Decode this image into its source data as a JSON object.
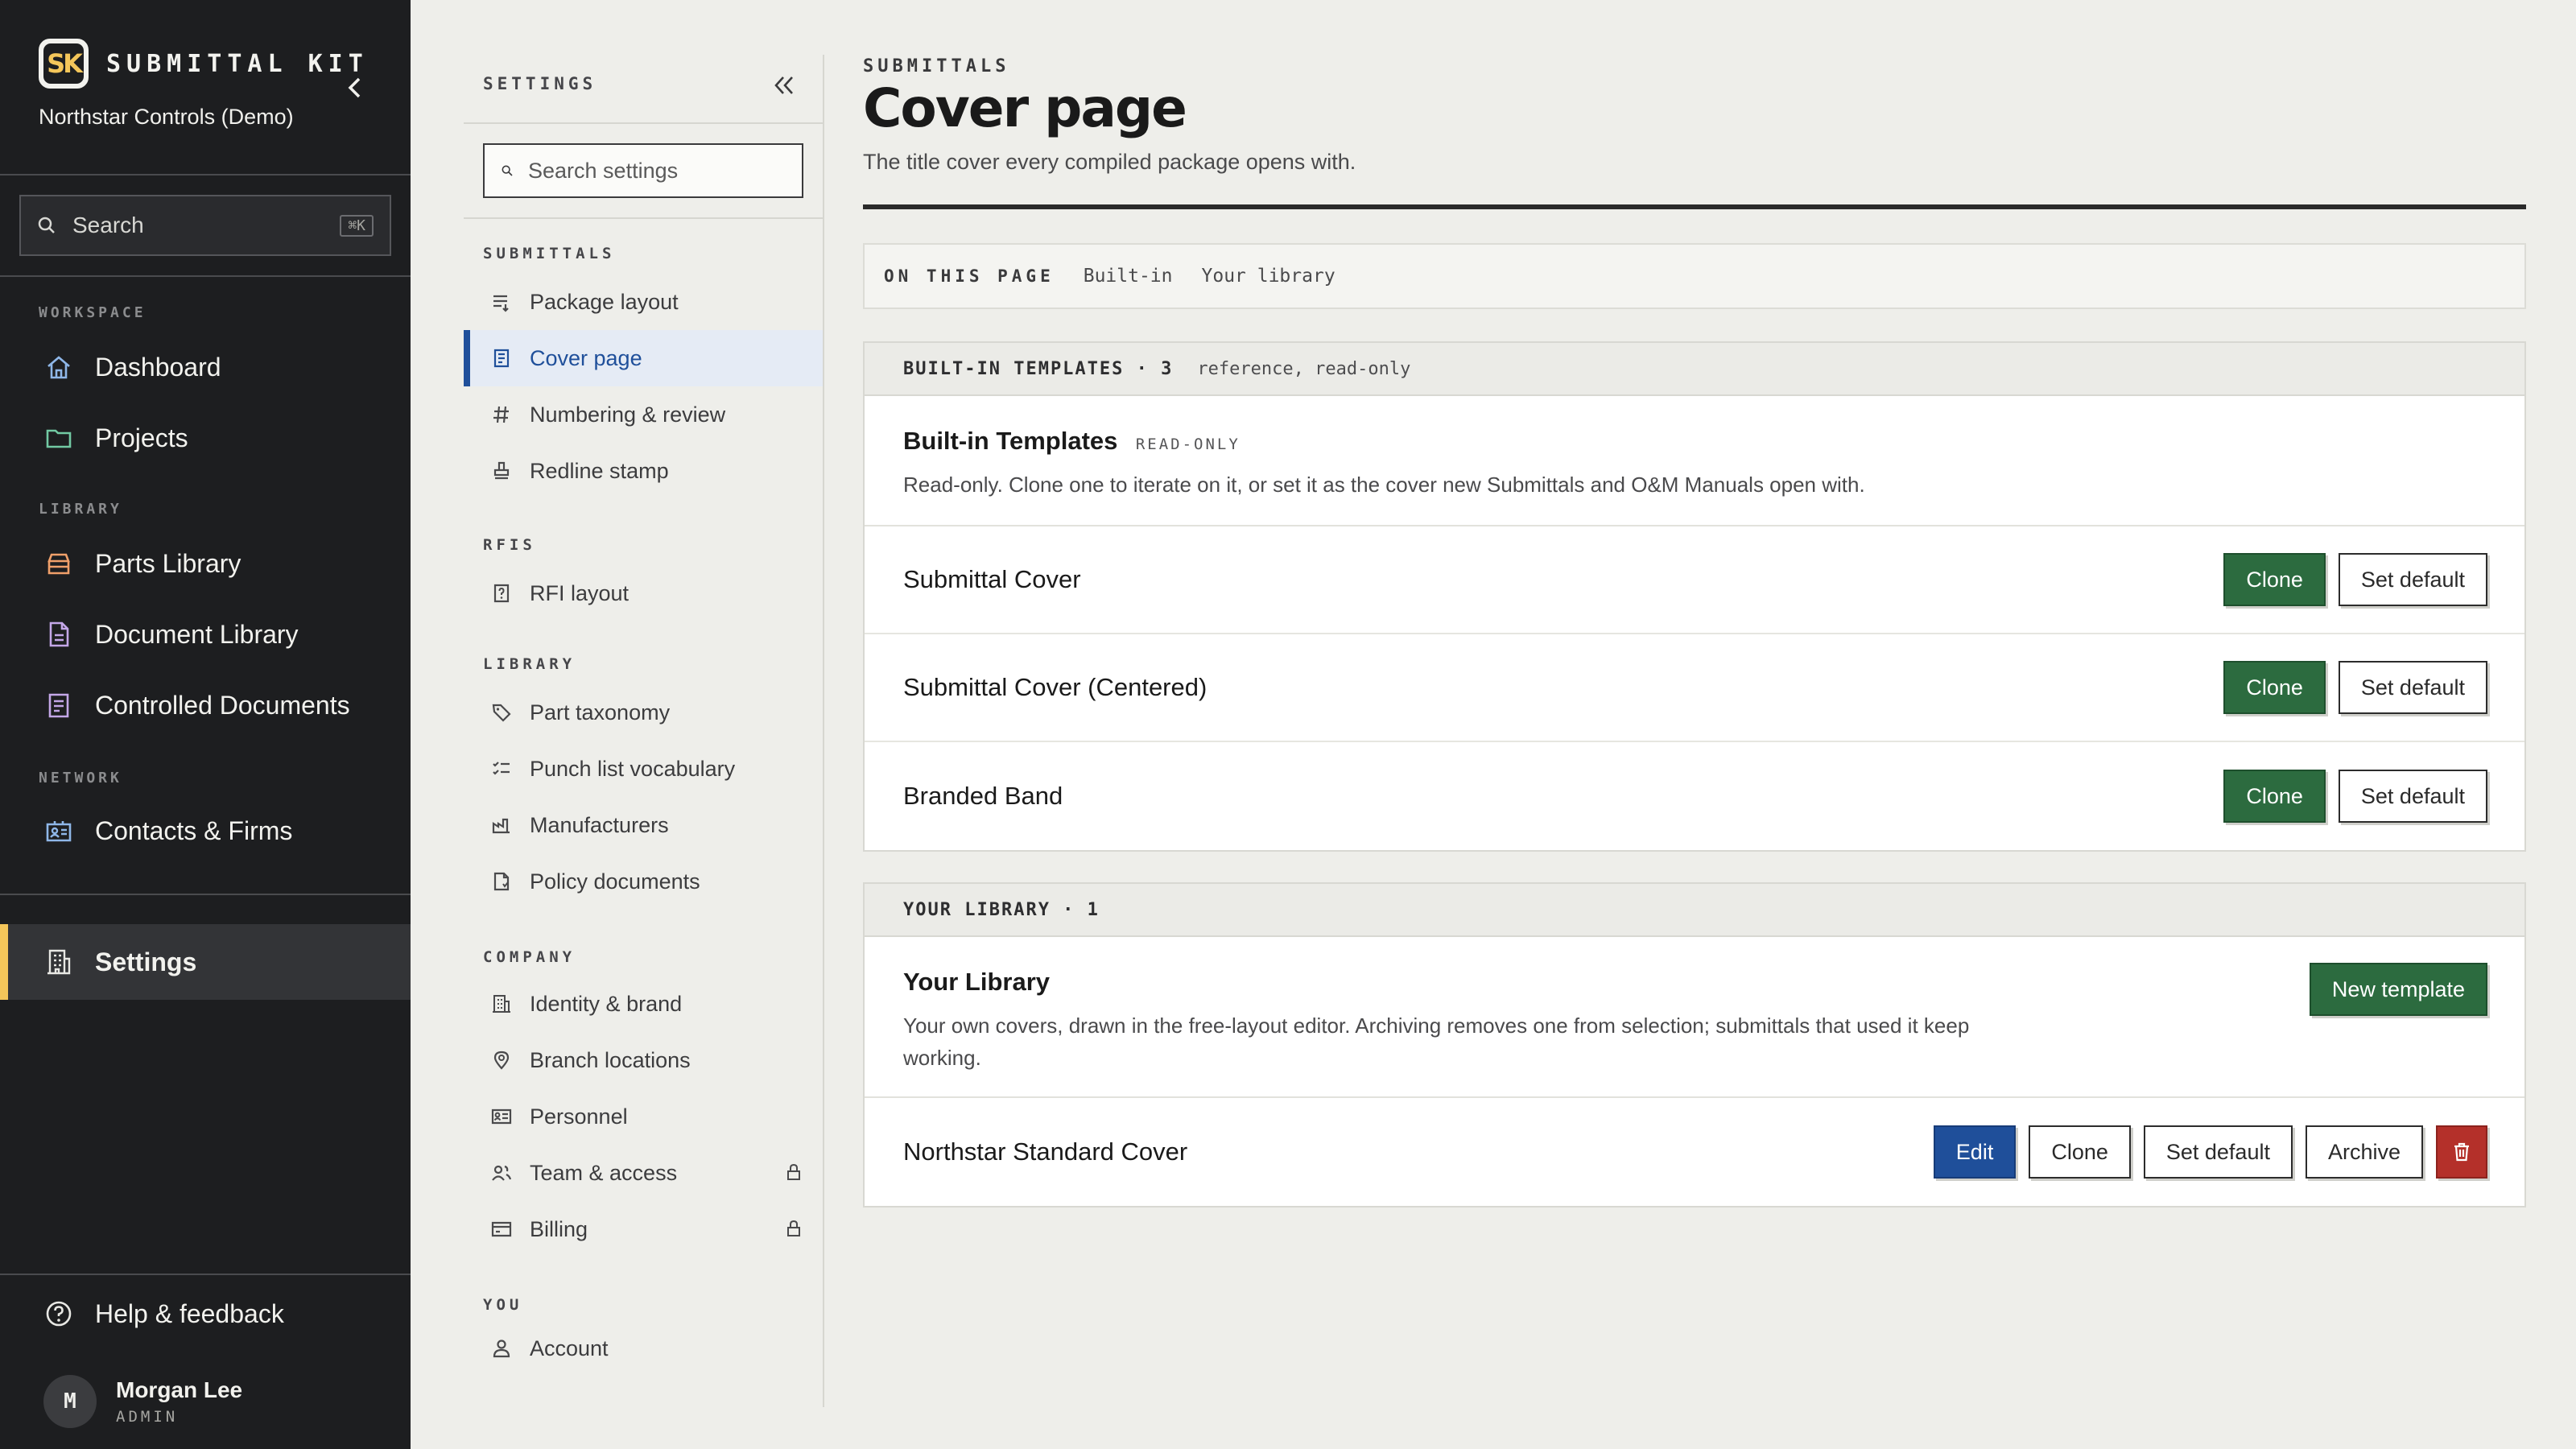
{
  "app": {
    "logo_text": "SK",
    "name": "SUBMITTAL KIT",
    "workspace": "Northstar Controls (Demo)",
    "search_label": "Search",
    "search_shortcut": "⌘K"
  },
  "sidebar": {
    "sections": [
      {
        "label": "WORKSPACE"
      },
      {
        "label": "LIBRARY"
      },
      {
        "label": "NETWORK"
      }
    ],
    "items": [
      {
        "label": "Dashboard",
        "icon": "home-icon"
      },
      {
        "label": "Projects",
        "icon": "folder-icon"
      },
      {
        "label": "Parts Library",
        "icon": "parts-box-icon"
      },
      {
        "label": "Document Library",
        "icon": "document-icon"
      },
      {
        "label": "Controlled Documents",
        "icon": "controlled-doc-icon"
      },
      {
        "label": "Contacts & Firms",
        "icon": "contacts-icon"
      },
      {
        "label": "Settings",
        "icon": "building-icon",
        "active": true
      }
    ],
    "help": "Help & feedback",
    "user": {
      "initial": "M",
      "name": "Morgan Lee",
      "role": "ADMIN"
    }
  },
  "settings": {
    "header": "SETTINGS",
    "search_placeholder": "Search settings",
    "sections": [
      {
        "label": "SUBMITTALS"
      },
      {
        "label": "RFIS"
      },
      {
        "label": "LIBRARY"
      },
      {
        "label": "COMPANY"
      },
      {
        "label": "YOU"
      }
    ],
    "items": [
      {
        "label": "Package layout"
      },
      {
        "label": "Cover page",
        "active": true
      },
      {
        "label": "Numbering & review"
      },
      {
        "label": "Redline stamp"
      },
      {
        "label": "RFI layout"
      },
      {
        "label": "Part taxonomy"
      },
      {
        "label": "Punch list vocabulary"
      },
      {
        "label": "Manufacturers"
      },
      {
        "label": "Policy documents"
      },
      {
        "label": "Identity & brand"
      },
      {
        "label": "Branch locations"
      },
      {
        "label": "Personnel"
      },
      {
        "label": "Team & access",
        "locked": true
      },
      {
        "label": "Billing",
        "locked": true
      },
      {
        "label": "Account"
      }
    ]
  },
  "page": {
    "eyebrow": "SUBMITTALS",
    "title": "Cover page",
    "subtitle": "The title cover every compiled package opens with.",
    "on_this_page": {
      "label": "ON THIS PAGE",
      "links": [
        "Built-in",
        "Your library"
      ]
    }
  },
  "builtin": {
    "header": "BUILT-IN TEMPLATES · 3",
    "note": "reference, read-only",
    "title": "Built-in Templates",
    "badge": "READ-ONLY",
    "description": "Read-only. Clone one to iterate on it, or set it as the cover new Submittals and O&M Manuals open with.",
    "clone_label": "Clone",
    "default_label": "Set default",
    "rows": [
      {
        "name": "Submittal Cover"
      },
      {
        "name": "Submittal Cover (Centered)"
      },
      {
        "name": "Branded Band"
      }
    ]
  },
  "library": {
    "header": "YOUR LIBRARY · 1",
    "title": "Your Library",
    "description": "Your own covers, drawn in the free-layout editor. Archiving removes one from selection; submittals that used it keep working.",
    "new_label": "New template",
    "rows": [
      {
        "name": "Northstar Standard Cover",
        "edit_label": "Edit",
        "clone_label": "Clone",
        "default_label": "Set default",
        "archive_label": "Archive"
      }
    ]
  },
  "colors": {
    "sidebar_bg": "#1d1e20",
    "accent_yellow": "#f4c65a",
    "clone_green": "#2c6b3f",
    "edit_blue": "#1f4f9a",
    "delete_red": "#b4302a"
  }
}
